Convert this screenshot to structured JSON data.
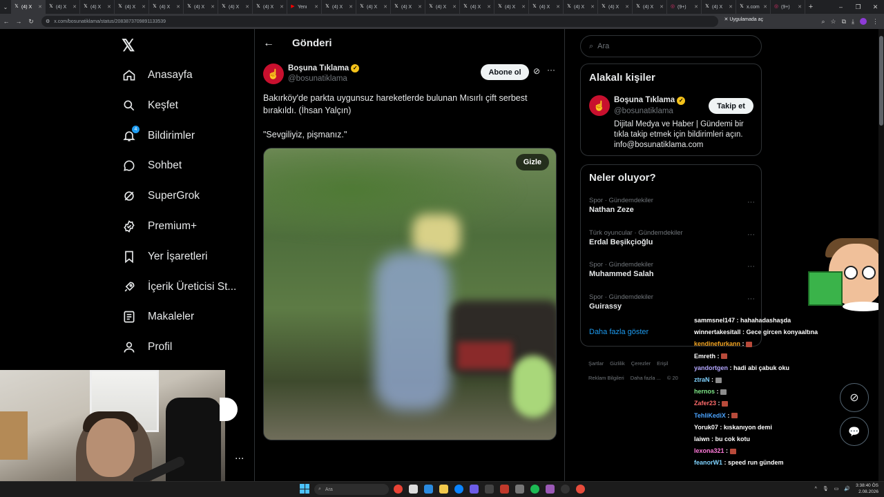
{
  "browser": {
    "tabs": [
      {
        "label": "(4) X",
        "active": true
      },
      {
        "label": "(4) X"
      },
      {
        "label": "(4) X"
      },
      {
        "label": "(4) X"
      },
      {
        "label": "(4) X"
      },
      {
        "label": "(4) X"
      },
      {
        "label": "(4) X"
      },
      {
        "label": "(4) X"
      },
      {
        "label": "Yeni",
        "icon": "youtube-icon"
      },
      {
        "label": "(4) X"
      },
      {
        "label": "(4) X"
      },
      {
        "label": "(4) X"
      },
      {
        "label": "(4) X"
      },
      {
        "label": "(4) X"
      },
      {
        "label": "(4) X"
      },
      {
        "label": "(4) X"
      },
      {
        "label": "(4) X"
      },
      {
        "label": "(4) X"
      },
      {
        "label": "(4) X"
      },
      {
        "label": "(9+)",
        "icon": "instagram-icon"
      },
      {
        "label": "(4) X"
      },
      {
        "label": "x.com"
      },
      {
        "label": "(9+)",
        "icon": "instagram-icon"
      }
    ],
    "new_tab": "+",
    "url": "x.com/bosunatiklama/status/2083873709891133539",
    "app_button": "Uygulamada aç"
  },
  "leftnav": {
    "logo": "𝕏",
    "items": [
      {
        "label": "Anasayfa",
        "icon": "home-icon"
      },
      {
        "label": "Keşfet",
        "icon": "search-icon"
      },
      {
        "label": "Bildirimler",
        "icon": "bell-icon",
        "badge": "4"
      },
      {
        "label": "Sohbet",
        "icon": "chat-icon"
      },
      {
        "label": "SuperGrok",
        "icon": "grok-icon"
      },
      {
        "label": "Premium+",
        "icon": "verified-icon"
      },
      {
        "label": "Yer İşaretleri",
        "icon": "bookmark-icon"
      },
      {
        "label": "İçerik Üreticisi St...",
        "icon": "rocket-icon"
      },
      {
        "label": "Makaleler",
        "icon": "article-icon"
      },
      {
        "label": "Profil",
        "icon": "profile-icon"
      }
    ],
    "more": "..."
  },
  "post": {
    "header_title": "Gönderi",
    "author_name": "Boşuna Tıklama",
    "author_handle": "@bosunatiklama",
    "subscribe_label": "Abone ol",
    "text": "Bakırköy'de parkta uygunsuz hareketlerde bulunan Mısırlı çift serbest bırakıldı. (İhsan Yalçın)",
    "quote": "\"Sevgiliyiz, pişmanız.\"",
    "media_hide_label": "Gizle"
  },
  "right": {
    "search_placeholder": "Ara",
    "related_title": "Alakalı kişiler",
    "related_person": {
      "name": "Boşuna Tıklama",
      "handle": "@bosunatiklama",
      "follow_label": "Takip et",
      "bio": "Dijital Medya ve Haber | Gündemi bir tıkla takip etmek için bildirimleri açın. info@bosunatiklama.com"
    },
    "trends_title": "Neler oluyor?",
    "trends": [
      {
        "category": "Spor · Gündemdekiler",
        "name": "Nathan Zeze"
      },
      {
        "category": "Türk oyuncular · Gündemdekiler",
        "name": "Erdal Beşikçioğlu"
      },
      {
        "category": "Spor · Gündemdekiler",
        "name": "Muhammed Salah"
      },
      {
        "category": "Spor · Gündemdekiler",
        "name": "Guirassy"
      }
    ],
    "show_more": "Daha fazla göster",
    "footer": [
      "Şartlar",
      "Gizlilik",
      "Çerezler",
      "Erişil",
      "Reklam Bilgileri",
      "Daha fazla ...",
      "© 20"
    ]
  },
  "chat": [
    {
      "user": "sammsnel147",
      "color": "#ffffff",
      "msg": "hahahadashaşda"
    },
    {
      "user": "winnertakesitall",
      "color": "#ffffff",
      "msg": "Gece gircen konyaaltına"
    },
    {
      "user": "kendinefurkann",
      "color": "#f5a623",
      "msg": "",
      "emote": "red"
    },
    {
      "user": "Emreth",
      "color": "#ffffff",
      "msg": "",
      "emote": "red"
    },
    {
      "user": "yandortgen",
      "color": "#b4a7ff",
      "msg": "hadi abi çabuk oku"
    },
    {
      "user": "ztraN",
      "color": "#7fd3ff",
      "msg": "",
      "emote": "grey"
    },
    {
      "user": "hernos",
      "color": "#7ee787",
      "msg": "",
      "emote": "grey"
    },
    {
      "user": "Zafer23",
      "color": "#ff6b6b",
      "msg": "",
      "emote": "red"
    },
    {
      "user": "TehliKediX",
      "color": "#4aa3ff",
      "msg": "",
      "emote": "red"
    },
    {
      "user": "Yoruk07",
      "color": "#ffffff",
      "msg": "kıskanıyon demi"
    },
    {
      "user": "laiwn",
      "color": "#ffffff",
      "msg": "bu cok kotu"
    },
    {
      "user": "lexona321",
      "color": "#ff7ad9",
      "msg": "",
      "emote": "red"
    },
    {
      "user": "feanorW1",
      "color": "#7fd3ff",
      "msg": "speed run gündem"
    }
  ],
  "taskbar": {
    "search_placeholder": "Ara",
    "time": "3:38:40 ÖS",
    "date": "2.08.2026"
  }
}
